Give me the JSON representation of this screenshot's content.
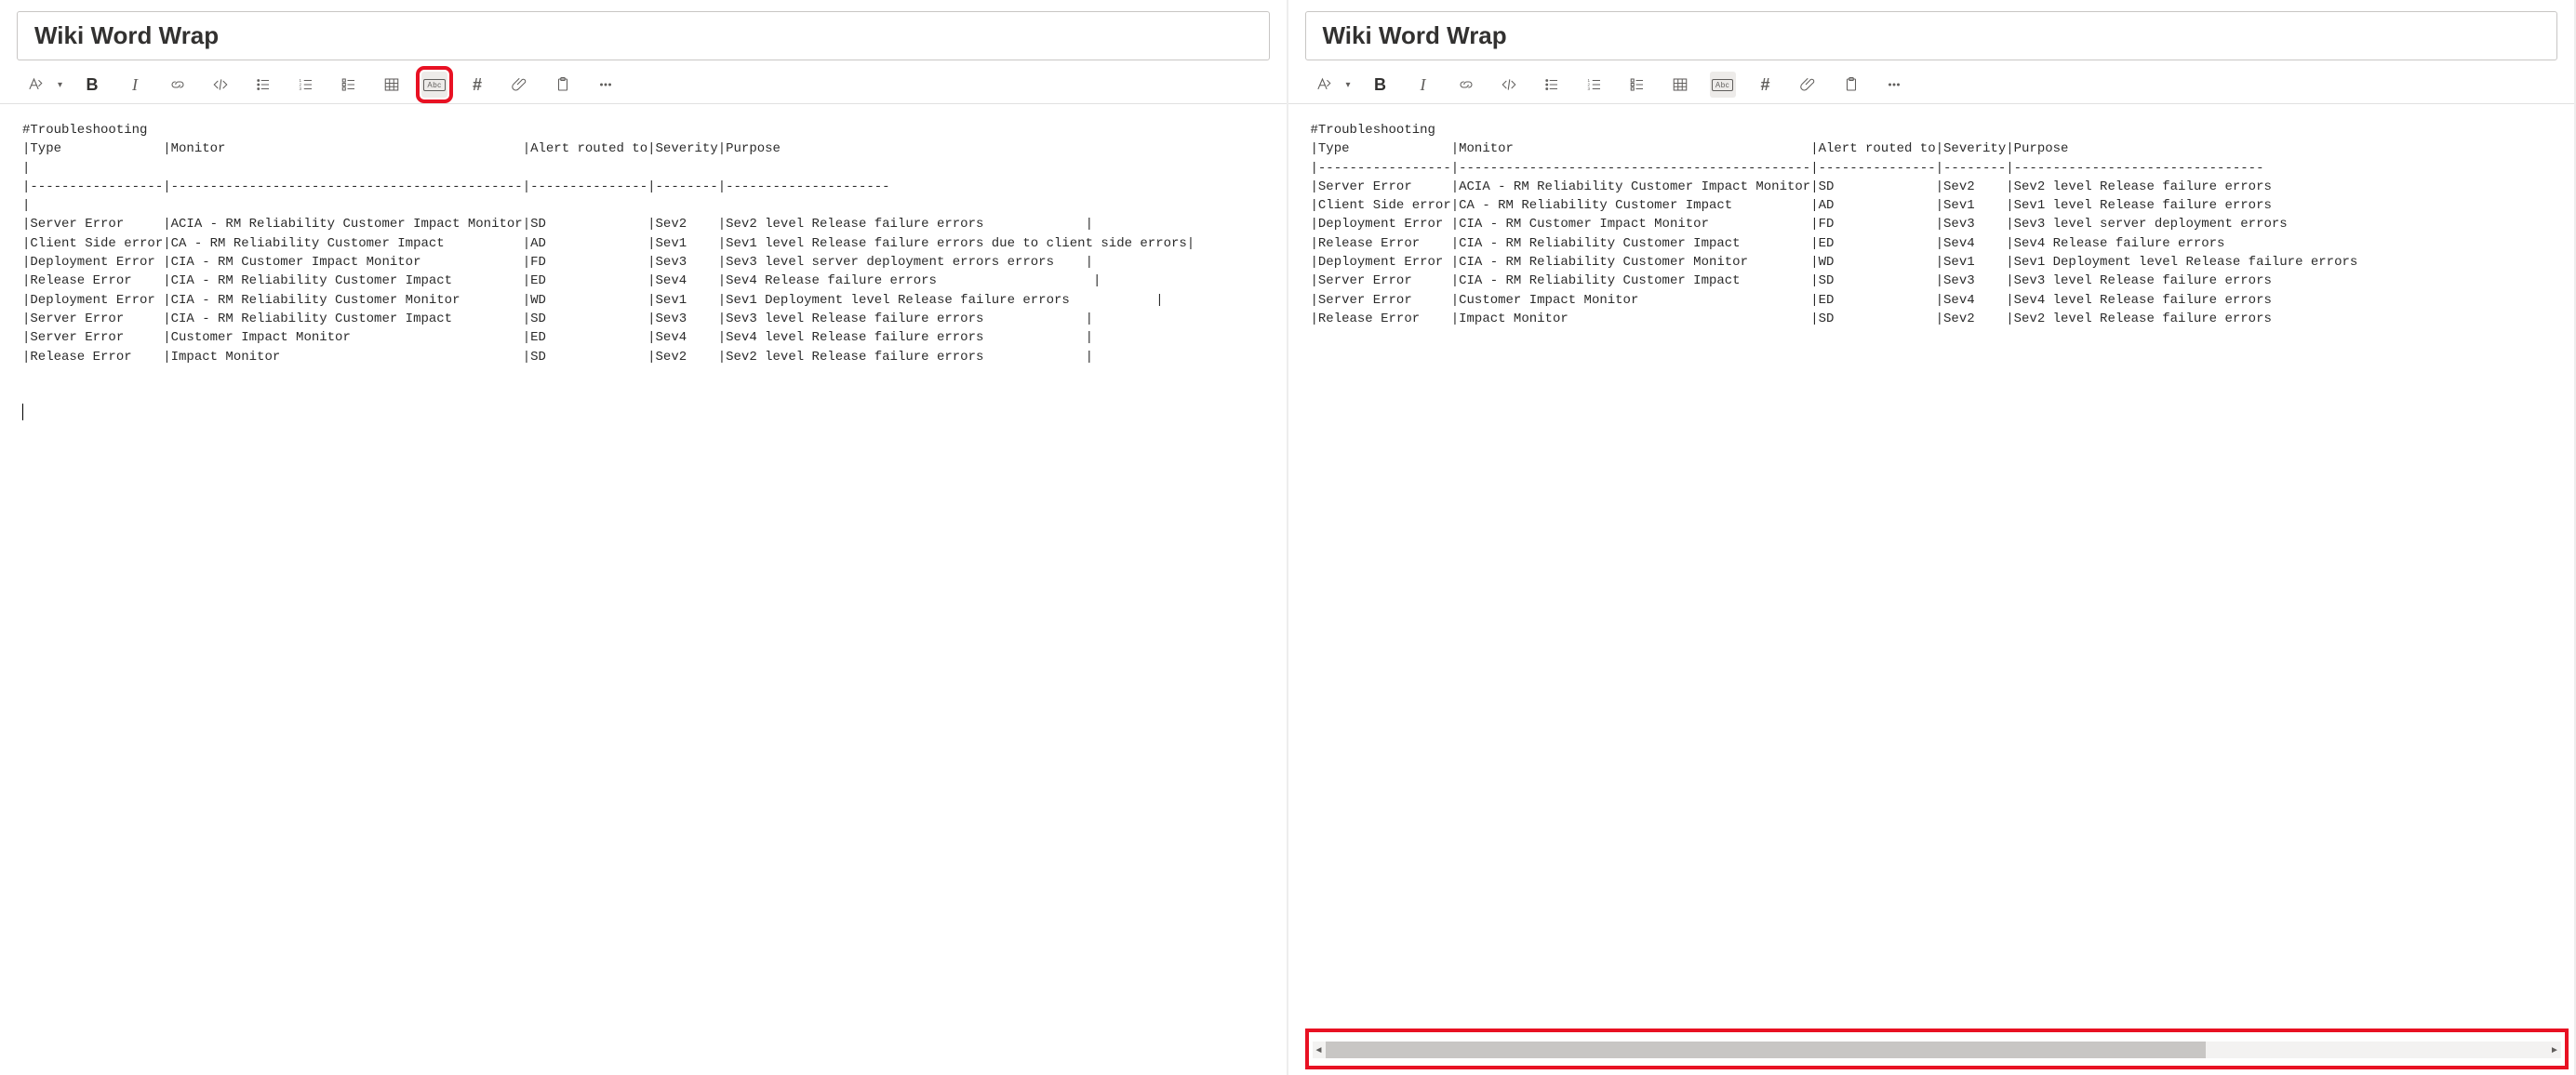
{
  "title": "Wiki Word Wrap",
  "wrap_label": "Abc",
  "left_content": "#Troubleshooting\n|Type             |Monitor                                      |Alert routed to|Severity|Purpose\n|\n|-----------------|---------------------------------------------|---------------|--------|---------------------\n|\n|Server Error     |ACIA - RM Reliability Customer Impact Monitor|SD             |Sev2    |Sev2 level Release failure errors             |\n|Client Side error|CA - RM Reliability Customer Impact          |AD             |Sev1    |Sev1 level Release failure errors due to client side errors|\n|Deployment Error |CIA - RM Customer Impact Monitor             |FD             |Sev3    |Sev3 level server deployment errors errors    |\n|Release Error    |CIA - RM Reliability Customer Impact         |ED             |Sev4    |Sev4 Release failure errors                    |\n|Deployment Error |CIA - RM Reliability Customer Monitor        |WD             |Sev1    |Sev1 Deployment level Release failure errors           |\n|Server Error     |CIA - RM Reliability Customer Impact         |SD             |Sev3    |Sev3 level Release failure errors             |\n|Server Error     |Customer Impact Monitor                      |ED             |Sev4    |Sev4 level Release failure errors             |\n|Release Error    |Impact Monitor                               |SD             |Sev2    |Sev2 level Release failure errors             |\n",
  "right_content": "#Troubleshooting\n|Type             |Monitor                                      |Alert routed to|Severity|Purpose\n|-----------------|---------------------------------------------|---------------|--------|--------------------------------\n|Server Error     |ACIA - RM Reliability Customer Impact Monitor|SD             |Sev2    |Sev2 level Release failure errors\n|Client Side error|CA - RM Reliability Customer Impact          |AD             |Sev1    |Sev1 level Release failure errors\n|Deployment Error |CIA - RM Customer Impact Monitor             |FD             |Sev3    |Sev3 level server deployment errors\n|Release Error    |CIA - RM Reliability Customer Impact         |ED             |Sev4    |Sev4 Release failure errors\n|Deployment Error |CIA - RM Reliability Customer Monitor        |WD             |Sev1    |Sev1 Deployment level Release failure errors\n|Server Error     |CIA - RM Reliability Customer Impact         |SD             |Sev3    |Sev3 level Release failure errors\n|Server Error     |Customer Impact Monitor                      |ED             |Sev4    |Sev4 level Release failure errors\n|Release Error    |Impact Monitor                               |SD             |Sev2    |Sev2 level Release failure errors\n"
}
